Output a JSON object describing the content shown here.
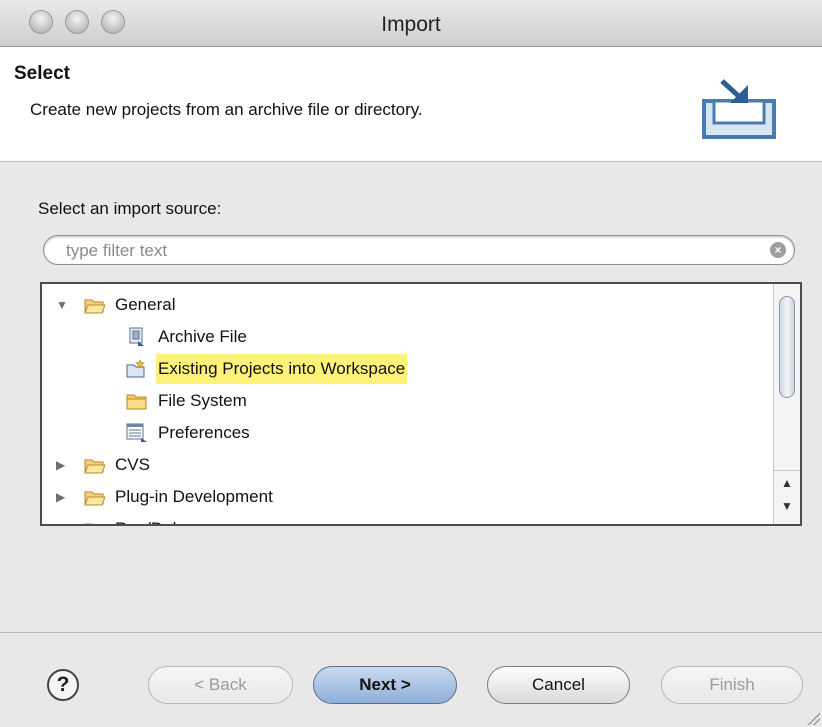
{
  "window": {
    "title": "Import"
  },
  "banner": {
    "title": "Select",
    "description": "Create new projects from an archive file or directory.",
    "icon": "import-wizard-icon"
  },
  "source": {
    "label": "Select an import source:",
    "filter_placeholder": "type filter text",
    "filter_value": ""
  },
  "tree": {
    "items": [
      {
        "label": "General",
        "expanded": true,
        "icon": "folder-open-icon"
      },
      {
        "label": "Archive File",
        "icon": "archive-file-icon"
      },
      {
        "label": "Existing Projects into Workspace",
        "icon": "project-folder-icon",
        "highlighted": true
      },
      {
        "label": "File System",
        "icon": "folder-icon"
      },
      {
        "label": "Preferences",
        "icon": "preferences-icon"
      },
      {
        "label": "CVS",
        "expanded": false,
        "icon": "folder-icon"
      },
      {
        "label": "Plug-in Development",
        "expanded": false,
        "icon": "folder-icon"
      },
      {
        "label": "Run/Debug",
        "expanded": false,
        "icon": "folder-icon"
      }
    ]
  },
  "buttons": {
    "help": "?",
    "back": "< Back",
    "next": "Next >",
    "cancel": "Cancel",
    "finish": "Finish"
  },
  "colors": {
    "highlight": "#fff27a",
    "default_button": "#8fb0d9"
  }
}
